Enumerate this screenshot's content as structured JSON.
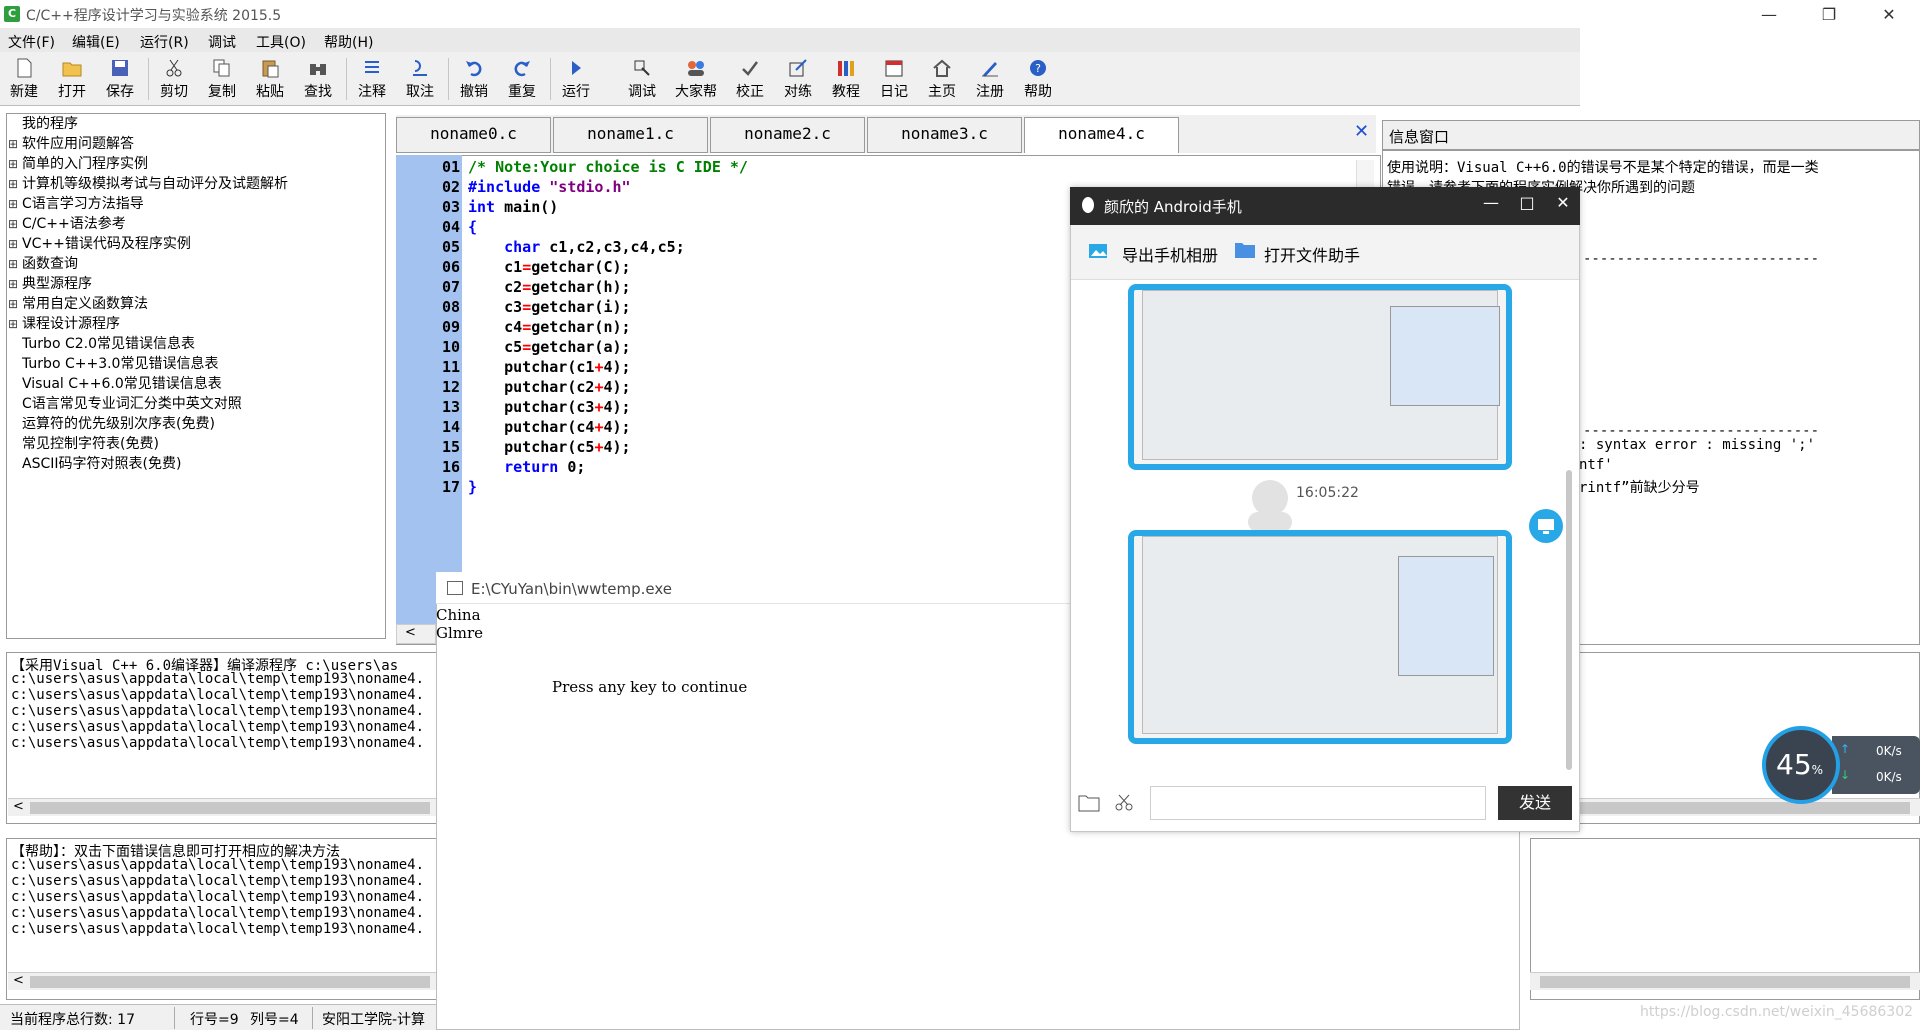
{
  "window": {
    "title": "C/C++程序设计学习与实验系统 2015.5",
    "icon_letter": "C",
    "controls": [
      "—",
      "❐",
      "✕"
    ]
  },
  "menu": [
    "文件(F)",
    "编辑(E)",
    "运行(R)",
    "调试",
    "工具(O)",
    "帮助(H)"
  ],
  "toolbar": [
    {
      "label": "新建",
      "icon": "new-file-icon"
    },
    {
      "label": "打开",
      "icon": "open-folder-icon"
    },
    {
      "label": "保存",
      "icon": "save-icon"
    },
    {
      "label": "剪切",
      "icon": "cut-icon"
    },
    {
      "label": "复制",
      "icon": "copy-icon"
    },
    {
      "label": "粘贴",
      "icon": "paste-icon"
    },
    {
      "label": "查找",
      "icon": "find-icon"
    },
    {
      "label": "注释",
      "icon": "comment-icon"
    },
    {
      "label": "取注",
      "icon": "uncomment-icon"
    },
    {
      "label": "撤销",
      "icon": "undo-icon"
    },
    {
      "label": "重复",
      "icon": "redo-icon"
    },
    {
      "label": "运行",
      "icon": "run-icon"
    },
    {
      "label": "调试",
      "icon": "debug-icon"
    },
    {
      "label": "大家帮",
      "icon": "community-icon"
    },
    {
      "label": "校正",
      "icon": "check-icon"
    },
    {
      "label": "对练",
      "icon": "practice-icon"
    },
    {
      "label": "教程",
      "icon": "tutorial-icon"
    },
    {
      "label": "日记",
      "icon": "diary-icon"
    },
    {
      "label": "主页",
      "icon": "home-icon"
    },
    {
      "label": "注册",
      "icon": "register-icon"
    },
    {
      "label": "帮助",
      "icon": "help-icon"
    }
  ],
  "tree": [
    {
      "label": "我的程序",
      "expand": ""
    },
    {
      "label": "软件应用问题解答",
      "expand": "⊞"
    },
    {
      "label": "简单的入门程序实例",
      "expand": "⊞"
    },
    {
      "label": "计算机等级模拟考试与自动评分及试题解析",
      "expand": "⊞"
    },
    {
      "label": "C语言学习方法指导",
      "expand": "⊞"
    },
    {
      "label": "C/C++语法参考",
      "expand": "⊞"
    },
    {
      "label": "VC++错误代码及程序实例",
      "expand": "⊞"
    },
    {
      "label": "函数查询",
      "expand": "⊞"
    },
    {
      "label": "典型源程序",
      "expand": "⊞"
    },
    {
      "label": "常用自定义函数算法",
      "expand": "⊞"
    },
    {
      "label": "课程设计源程序",
      "expand": "⊞"
    },
    {
      "label": "Turbo C2.0常见错误信息表",
      "expand": ""
    },
    {
      "label": "Turbo C++3.0常见错误信息表",
      "expand": ""
    },
    {
      "label": "Visual C++6.0常见错误信息表",
      "expand": ""
    },
    {
      "label": "C语言常见专业词汇分类中英文对照",
      "expand": ""
    },
    {
      "label": "运算符的优先级别次序表(免费)",
      "expand": ""
    },
    {
      "label": "常见控制字符表(免费)",
      "expand": ""
    },
    {
      "label": "ASCII码字符对照表(免费)",
      "expand": ""
    }
  ],
  "editor": {
    "tabs": [
      "noname0.c",
      "noname1.c",
      "noname2.c",
      "noname3.c",
      "noname4.c"
    ],
    "active_tab": 4,
    "close": "✕",
    "line_numbers": [
      "01",
      "02",
      "03",
      "04",
      "05",
      "06",
      "07",
      "08",
      "09",
      "10",
      "11",
      "12",
      "13",
      "14",
      "15",
      "16",
      "17"
    ],
    "lines": [
      [
        {
          "t": "/* Note:Your choice is C IDE */",
          "c": "cm"
        }
      ],
      [
        {
          "t": "#include ",
          "c": "kw"
        },
        {
          "t": "\"stdio.h\"",
          "c": "st"
        }
      ],
      [
        {
          "t": "int",
          "c": "kw"
        },
        {
          "t": " main()",
          "c": ""
        }
      ],
      [
        {
          "t": "{",
          "c": "kw"
        }
      ],
      [
        {
          "t": "    ",
          "c": ""
        },
        {
          "t": "char",
          "c": "kw"
        },
        {
          "t": " c1,c2,c3,c4,c5;",
          "c": ""
        }
      ],
      [
        {
          "t": "    c1",
          "c": ""
        },
        {
          "t": "=",
          "c": "op"
        },
        {
          "t": "getchar(C);",
          "c": ""
        }
      ],
      [
        {
          "t": "    c2",
          "c": ""
        },
        {
          "t": "=",
          "c": "op"
        },
        {
          "t": "getchar(h);",
          "c": ""
        }
      ],
      [
        {
          "t": "    c3",
          "c": ""
        },
        {
          "t": "=",
          "c": "op"
        },
        {
          "t": "getchar(i);",
          "c": ""
        }
      ],
      [
        {
          "t": "    c4",
          "c": ""
        },
        {
          "t": "=",
          "c": "op"
        },
        {
          "t": "getchar(n);",
          "c": ""
        }
      ],
      [
        {
          "t": "    c5",
          "c": ""
        },
        {
          "t": "=",
          "c": "op"
        },
        {
          "t": "getchar(a);",
          "c": ""
        }
      ],
      [
        {
          "t": "    putchar(c1",
          "c": ""
        },
        {
          "t": "+",
          "c": "op"
        },
        {
          "t": "4);",
          "c": ""
        }
      ],
      [
        {
          "t": "    putchar(c2",
          "c": ""
        },
        {
          "t": "+",
          "c": "op"
        },
        {
          "t": "4);",
          "c": ""
        }
      ],
      [
        {
          "t": "    putchar(c3",
          "c": ""
        },
        {
          "t": "+",
          "c": "op"
        },
        {
          "t": "4);",
          "c": ""
        }
      ],
      [
        {
          "t": "    putchar(c4",
          "c": ""
        },
        {
          "t": "+",
          "c": "op"
        },
        {
          "t": "4);",
          "c": ""
        }
      ],
      [
        {
          "t": "    putchar(c5",
          "c": ""
        },
        {
          "t": "+",
          "c": "op"
        },
        {
          "t": "4);",
          "c": ""
        }
      ],
      [
        {
          "t": "    ",
          "c": ""
        },
        {
          "t": "return",
          "c": "kw"
        },
        {
          "t": " 0;",
          "c": ""
        }
      ],
      [
        {
          "t": "}",
          "c": "kw"
        }
      ]
    ]
  },
  "info": {
    "header": "信息窗口",
    "line1": "使用说明：Visual C++6.0的错误号不是某个特定的错误，而是一类",
    "line2": "错误，请参考下面的程序实例解决你所遇到的问题",
    "dash1": "----------------------------",
    "dash2": "----------------------------",
    "err1": ": syntax error : missing ';'",
    "err2": "ntf'",
    "err3": "rintf”前缺少分号"
  },
  "compile": {
    "header": "【采用Visual C++ 6.0编译器】编译源程序 c:\\users\\as",
    "lines": [
      "c:\\users\\asus\\appdata\\local\\temp\\temp193\\noname4.",
      "c:\\users\\asus\\appdata\\local\\temp\\temp193\\noname4.",
      "c:\\users\\asus\\appdata\\local\\temp\\temp193\\noname4.",
      "c:\\users\\asus\\appdata\\local\\temp\\temp193\\noname4.",
      "c:\\users\\asus\\appdata\\local\\temp\\temp193\\noname4."
    ]
  },
  "help": {
    "header": "【帮助】：双击下面错误信息即可打开相应的解决方法",
    "lines": [
      "c:\\users\\asus\\appdata\\local\\temp\\temp193\\noname4.",
      "c:\\users\\asus\\appdata\\local\\temp\\temp193\\noname4.",
      "c:\\users\\asus\\appdata\\local\\temp\\temp193\\noname4.",
      "c:\\users\\asus\\appdata\\local\\temp\\temp193\\noname4.",
      "c:\\users\\asus\\appdata\\local\\temp\\temp193\\noname4."
    ]
  },
  "status": {
    "total": "当前程序总行数:  17",
    "row": "行号=9",
    "col": "列号=4",
    "org": "安阳工学院-计算"
  },
  "console": {
    "title": "E:\\CYuYan\\bin\\wwtemp.exe",
    "line1": "China",
    "line2": "Glmre",
    "prompt": "Press any key to continue"
  },
  "phone": {
    "title": "颜欣的 Android手机",
    "export": "导出手机相册",
    "assistant": "打开文件助手",
    "time": "16:05:22",
    "send": "发送",
    "controls": [
      "—",
      "□",
      "✕"
    ]
  },
  "speed": {
    "percent": "45",
    "unit": "%",
    "up": "0K/s",
    "down": "0K/s",
    "load_fraction": 0.45
  },
  "watermark": "https://blog.csdn.net/weixin_45686302",
  "colors": {
    "gutter": "#a4c2ef",
    "keyword": "#0000ff",
    "comment": "#008000",
    "string": "#800080",
    "operator": "#ff0000",
    "phone_accent": "#29a8e8"
  }
}
